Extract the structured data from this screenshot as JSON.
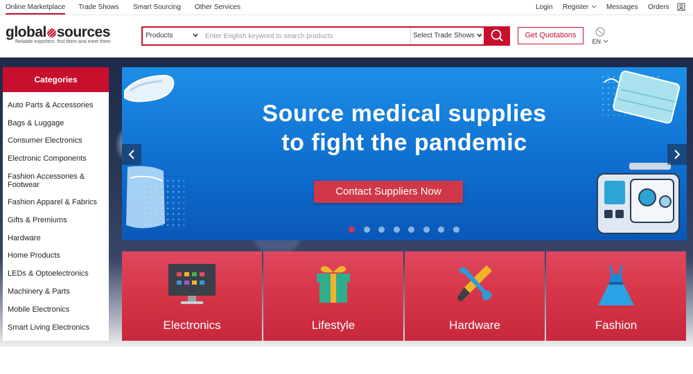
{
  "topnav": {
    "online_marketplace": "Online Marketplace",
    "trade_shows": "Trade Shows",
    "smart_sourcing": "Smart Sourcing",
    "other_services": "Other Services",
    "login": "Login",
    "register": "Register",
    "messages": "Messages",
    "orders": "Orders"
  },
  "header": {
    "logo_left": "global",
    "logo_right": "sources",
    "logo_tagline": "Reliable exporters: find them and meet them",
    "search_category": "Products",
    "search_placeholder": "Enter English keyword to search products",
    "trade_show_select": "Select Trade Shows",
    "quote_button": "Get Quotations",
    "language": "EN"
  },
  "sidebar": {
    "heading": "Categories",
    "items": [
      "Auto Parts & Accessories",
      "Bags & Luggage",
      "Consumer Electronics",
      "Electronic Components",
      "Fashion Accessories & Footwear",
      "Fashion Apparel & Fabrics",
      "Gifts & Premiums",
      "Hardware",
      "Home Products",
      "LEDs & Optoelectronics",
      "Machinery & Parts",
      "Mobile Electronics",
      "Smart Living Electronics"
    ]
  },
  "banner": {
    "title_line1": "Source medical supplies",
    "title_line2": "to fight the pandemic",
    "cta": "Contact Suppliers Now",
    "slide_count": 8,
    "active_slide": 1
  },
  "tiles": [
    "Electronics",
    "Lifestyle",
    "Hardware",
    "Fashion"
  ],
  "colors": {
    "brand_red": "#c8102e",
    "banner_blue": "#0f6fd0",
    "tile_red": "#d63447"
  }
}
